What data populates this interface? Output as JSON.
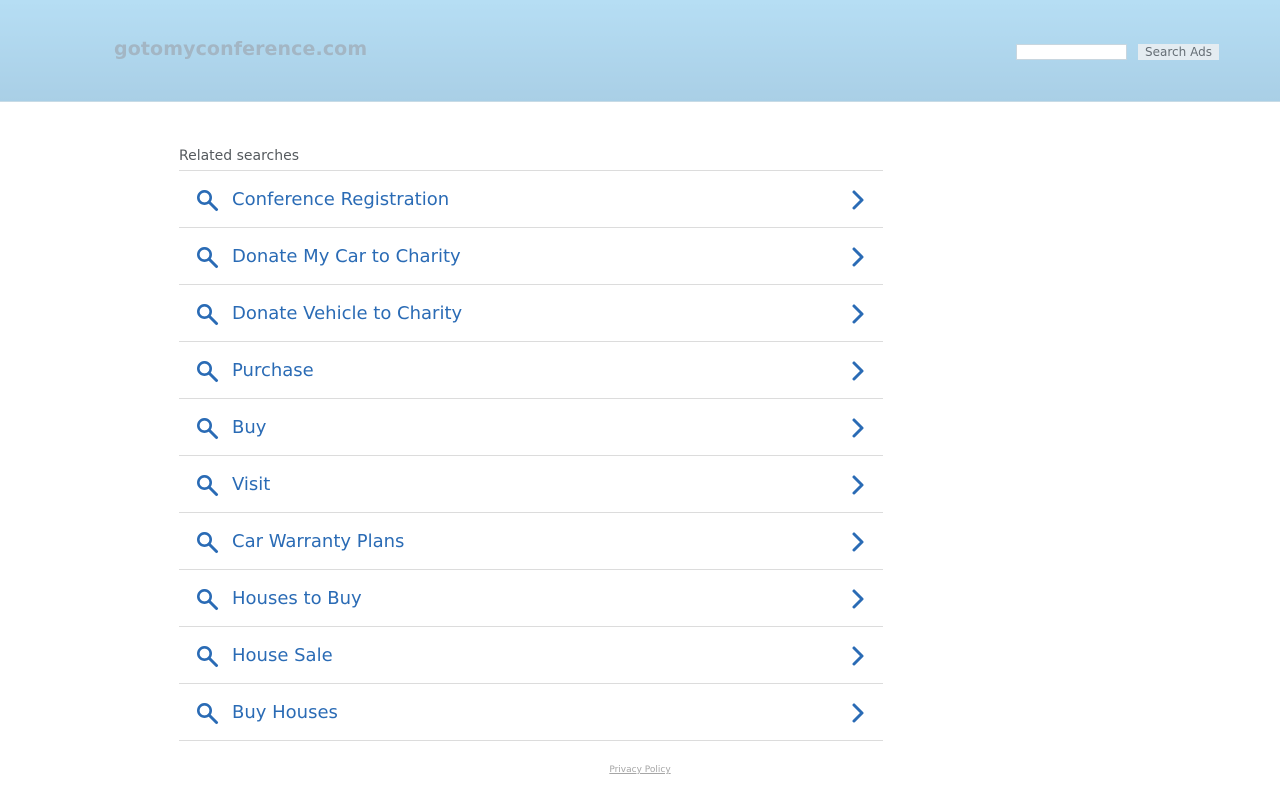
{
  "header": {
    "domain": "gotomyconference.com",
    "search_placeholder": "",
    "search_value": "",
    "search_button": "Search Ads"
  },
  "related": {
    "title": "Related searches",
    "items": [
      {
        "label": "Conference Registration"
      },
      {
        "label": "Donate My Car to Charity"
      },
      {
        "label": "Donate Vehicle to Charity"
      },
      {
        "label": "Purchase"
      },
      {
        "label": "Buy"
      },
      {
        "label": "Visit"
      },
      {
        "label": "Car Warranty Plans"
      },
      {
        "label": "Houses to Buy"
      },
      {
        "label": "House Sale"
      },
      {
        "label": "Buy Houses"
      }
    ]
  },
  "footer": {
    "privacy": "Privacy Policy"
  },
  "colors": {
    "link": "#2a6bb5",
    "header_bg": "#b6def4",
    "domain": "#a3b6c4"
  },
  "icons": {
    "item_left": "search-icon",
    "item_right": "chevron-right-icon"
  }
}
